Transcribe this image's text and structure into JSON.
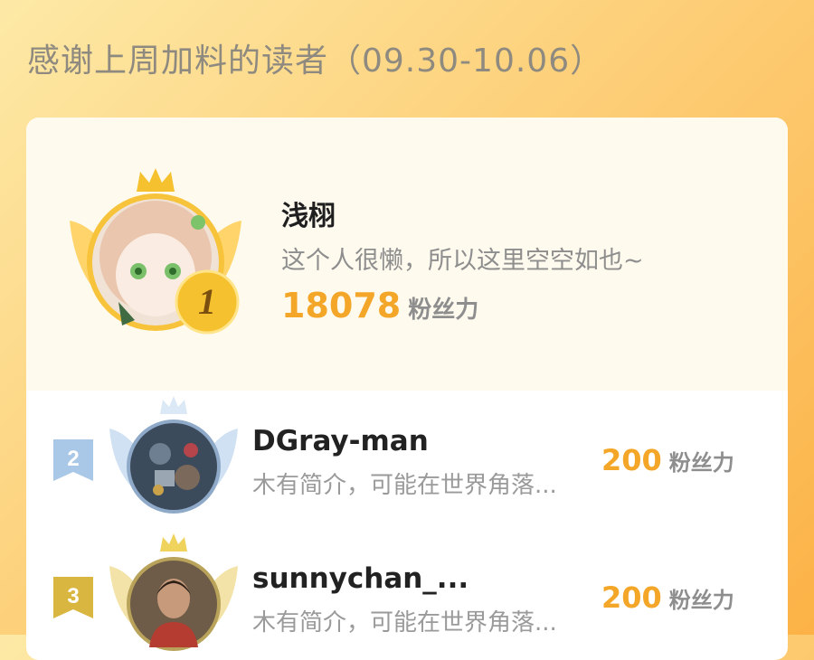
{
  "header": {
    "title": "感谢上周加料的读者（09.30-10.06）"
  },
  "top_reader": {
    "rank": "1",
    "name": "浅栩",
    "bio": "这个人很懒，所以这里空空如也~",
    "score": "18078",
    "score_unit": "粉丝力"
  },
  "readers": [
    {
      "rank": "2",
      "name": "DGray-man",
      "bio": "木有简介，可能在世界角落...",
      "score": "200",
      "score_unit": "粉丝力"
    },
    {
      "rank": "3",
      "name": "sunnychan_...",
      "bio": "木有简介，可能在世界角落...",
      "score": "200",
      "score_unit": "粉丝力"
    }
  ],
  "colors": {
    "accent": "#f3a628",
    "gold": "#f5c23a",
    "silver": "#a9c7e6",
    "bronze": "#d9b640",
    "background": "#fdd07a"
  }
}
